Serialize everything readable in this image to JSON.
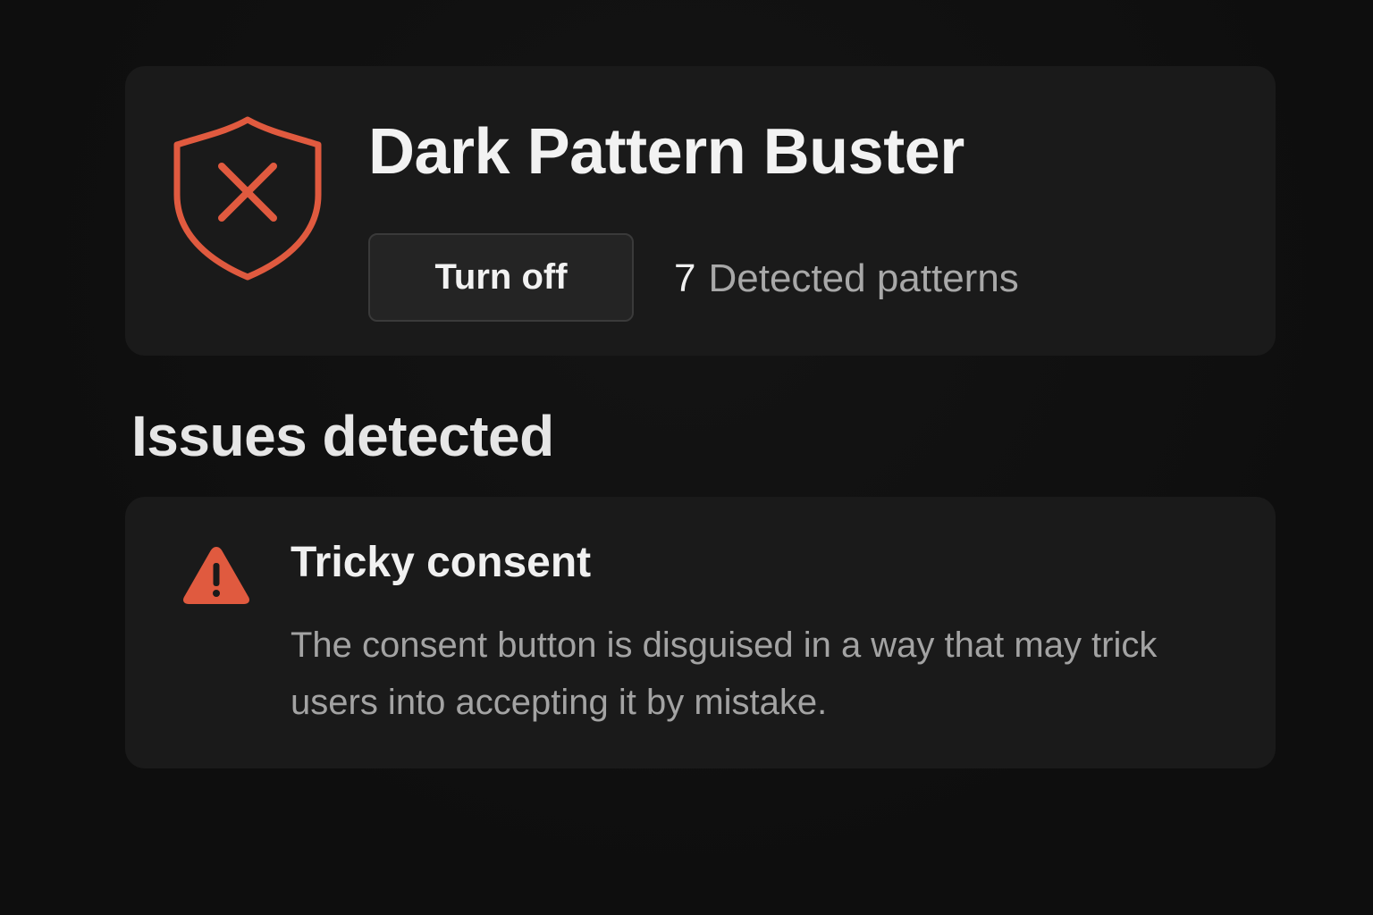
{
  "header": {
    "title": "Dark Pattern Buster",
    "toggle_button_label": "Turn off",
    "detected_count": "7",
    "detected_label": "Detected patterns",
    "shield_icon": "shield-x-icon"
  },
  "issues_section": {
    "heading": "Issues detected",
    "items": [
      {
        "icon": "warning-icon",
        "title": "Tricky consent",
        "description": "The consent button is disguised in a way that may trick users into accepting it by mistake."
      }
    ]
  },
  "colors": {
    "background": "#0f0f0f",
    "card": "#1a1a1a",
    "accent": "#e05a3f",
    "text_primary": "#f2f2f2",
    "text_secondary": "#a8a8a8",
    "button_bg": "#242424",
    "button_border": "#3a3a3a"
  }
}
